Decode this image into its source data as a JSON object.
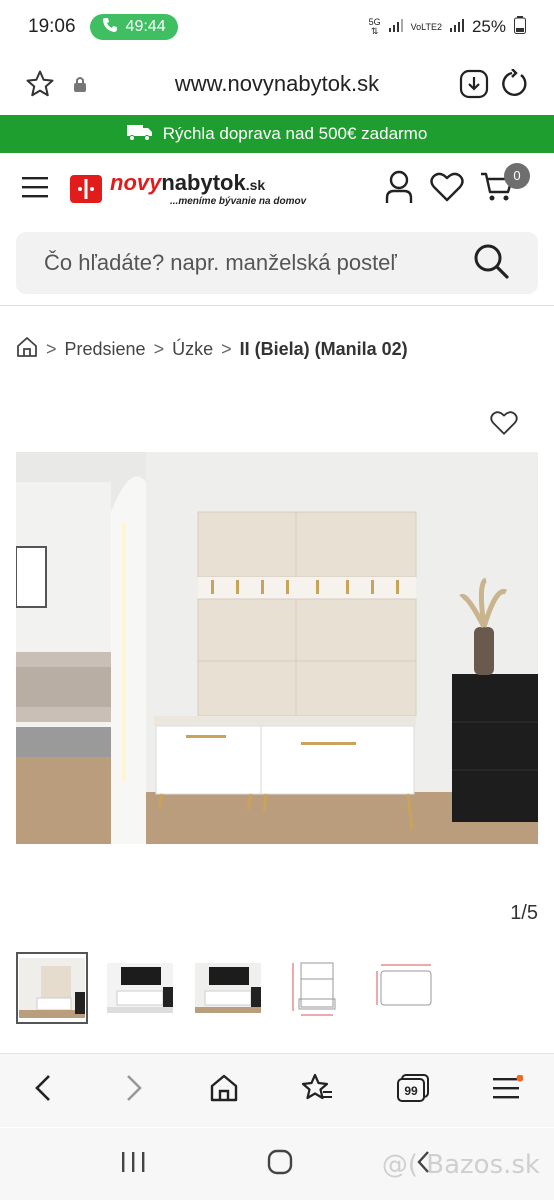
{
  "status": {
    "time": "19:06",
    "call_timer": "49:44",
    "network": "5G",
    "network2": "VoLTE2",
    "battery": "25%"
  },
  "browser": {
    "url": "www.novynabytok.sk"
  },
  "promo": {
    "text": "Rýchla doprava nad 500€ zadarmo"
  },
  "header": {
    "logo_part1": "novy",
    "logo_part2": "nabytok",
    "logo_tld": ".sk",
    "tagline": "...meníme bývanie na domov",
    "cart_count": "0"
  },
  "search": {
    "placeholder": "Čo hľadáte? napr. manželská posteľ"
  },
  "breadcrumb": {
    "items": [
      "Predsiene",
      "Úzke"
    ],
    "current": "II (Biela) (Manila 02)",
    "separator": ">"
  },
  "gallery": {
    "counter": "1/5"
  },
  "watermark": "@( Bazos.sk",
  "colors": {
    "promo": "#1e9e2e",
    "brand_red": "#e21b1b",
    "badge": "#6e6e6e"
  }
}
